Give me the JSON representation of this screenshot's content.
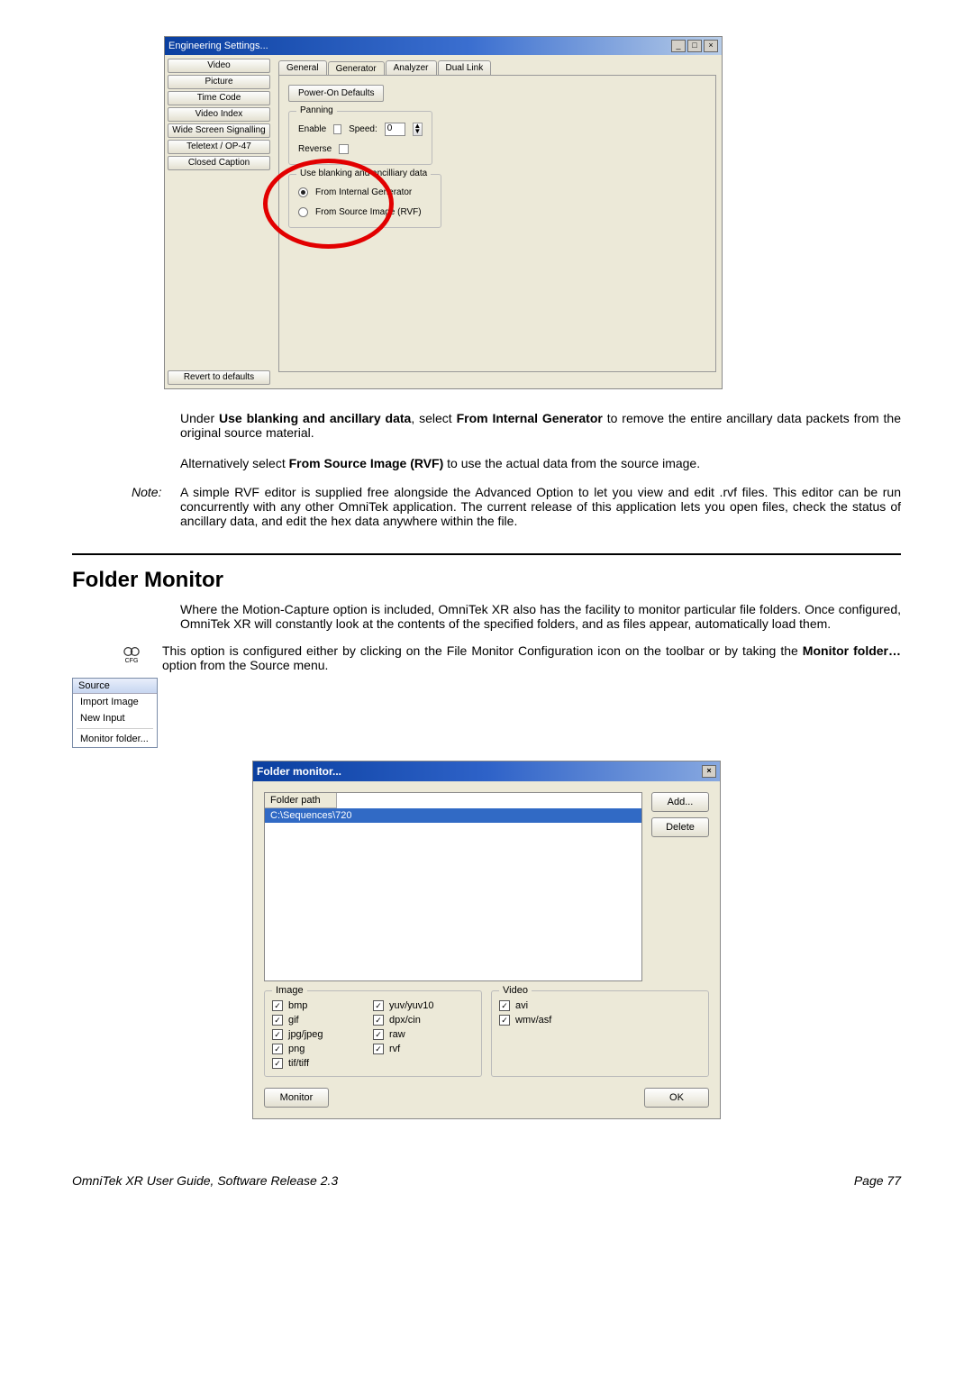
{
  "engSettings": {
    "title": "Engineering Settings...",
    "winbtns": {
      "min": "_",
      "max": "□",
      "close": "×"
    },
    "side": {
      "items": [
        "Video",
        "Picture",
        "Time Code",
        "Video Index",
        "Wide Screen Signalling",
        "Teletext / OP-47",
        "Closed Caption"
      ],
      "footer": "Revert to defaults"
    },
    "tabs": [
      "General",
      "Generator",
      "Analyzer",
      "Dual Link"
    ],
    "powerOn": "Power-On Defaults",
    "panning": {
      "legend": "Panning",
      "enable": "Enable",
      "speedLbl": "Speed:",
      "speedVal": "0",
      "reverse": "Reverse"
    },
    "blank": {
      "legend": "Use blanking and ancilliary data",
      "opt1": "From Internal Generator",
      "opt2": "From Source Image (RVF)"
    }
  },
  "text": {
    "p1a": "Under ",
    "p1b": "Use blanking and ancillary data",
    "p1c": ", select ",
    "p1d": "From Internal Generator",
    "p1e": " to remove the entire ancillary data packets from the original source material.",
    "p2a": "Alternatively select ",
    "p2b": "From Source Image (RVF)",
    "p2c": " to use the actual data from the source image.",
    "noteLabel": "Note:",
    "noteBody": "A simple RVF editor is supplied free alongside the Advanced Option to let you view and edit .rvf files. This editor can be run concurrently with any other OmniTek application. The current release of this application lets you open files, check the status of ancillary data, and edit the hex data anywhere within the file.",
    "h2": "Folder Monitor",
    "p3": "Where the Motion-Capture option is included, OmniTek XR also has the facility to monitor particular file folders. Once configured, OmniTek XR will constantly look at the contents of the specified folders, and as files appear, automatically load them.",
    "p4a": "This option is configured either by clicking on the File Monitor Configuration icon on the toolbar or by taking the ",
    "p4b": "Monitor folder…",
    "p4c": " option from the Source menu.",
    "iconLabel": "CFG"
  },
  "sourceMenu": {
    "header": "Source",
    "items": [
      "Import Image",
      "New Input"
    ],
    "items2": [
      "Monitor folder..."
    ]
  },
  "folderMonitor": {
    "title": "Folder monitor...",
    "closeBtn": "×",
    "colHeader": "Folder path",
    "row": "C:\\Sequences\\720",
    "addBtn": "Add...",
    "deleteBtn": "Delete",
    "imageLegend": "Image",
    "videoLegend": "Video",
    "imageFormats": [
      {
        "l": "bmp",
        "r": "yuv/yuv10"
      },
      {
        "l": "gif",
        "r": "dpx/cin"
      },
      {
        "l": "jpg/jpeg",
        "r": "raw"
      },
      {
        "l": "png",
        "r": "rvf"
      },
      {
        "l": "tif/tiff",
        "r": ""
      }
    ],
    "videoFormats": [
      "avi",
      "wmv/asf"
    ],
    "monitorBtn": "Monitor",
    "okBtn": "OK"
  },
  "footer": {
    "left": "OmniTek XR User Guide, Software Release 2.3",
    "right": "Page 77"
  }
}
